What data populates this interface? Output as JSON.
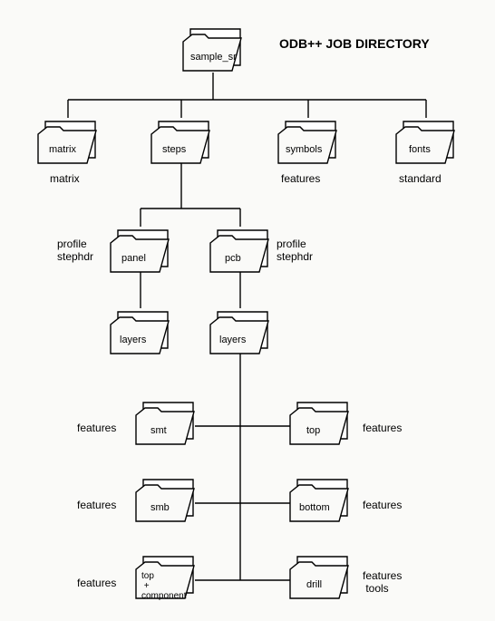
{
  "title": "ODB++ JOB DIRECTORY",
  "root": {
    "name": "sample_sr"
  },
  "level1": {
    "matrix": {
      "name": "matrix",
      "file": "matrix"
    },
    "steps": {
      "name": "steps"
    },
    "symbols": {
      "name": "symbols",
      "file": "features"
    },
    "fonts": {
      "name": "fonts",
      "file": "standard"
    }
  },
  "steps_children": {
    "panel": {
      "name": "panel",
      "files": "profile\nstephdr"
    },
    "pcb": {
      "name": "pcb",
      "files": "profile\nstephdr"
    }
  },
  "layers_panel": {
    "name": "layers"
  },
  "layers_pcb": {
    "name": "layers"
  },
  "layer_folders": {
    "smt": {
      "name": "smt",
      "file": "features"
    },
    "top": {
      "name": "top",
      "file": "features"
    },
    "smb": {
      "name": "smb",
      "file": "features"
    },
    "bottom": {
      "name": "bottom",
      "file": "features"
    },
    "topcomp": {
      "name": "top\n  +\ncomponent",
      "file": "features"
    },
    "drill": {
      "name": "drill",
      "file": "features\n tools"
    }
  }
}
